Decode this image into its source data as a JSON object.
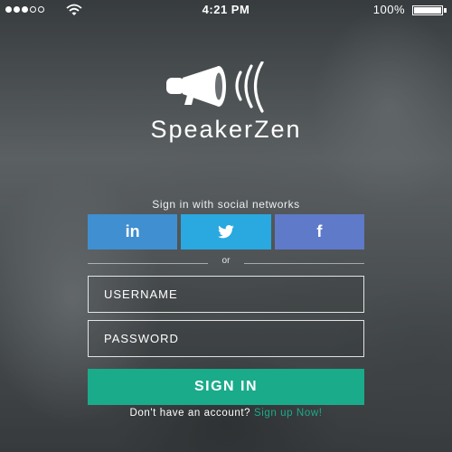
{
  "status_bar": {
    "time": "4:21 PM",
    "battery_percent": "100%",
    "battery_level": 1.0,
    "signal_bars_filled": 3,
    "signal_bars_total": 5
  },
  "brand": {
    "name": "SpeakerZen",
    "logo_icon": "megaphone-icon"
  },
  "social": {
    "label": "Sign in with social networks",
    "buttons": [
      {
        "text": "in",
        "icon": "linkedin-icon",
        "color": "#3f8fd1"
      },
      {
        "text": "",
        "icon": "twitter-icon",
        "color": "#2aa8e0"
      },
      {
        "text": "f",
        "icon": "facebook-icon",
        "color": "#5f7ac9"
      }
    ]
  },
  "divider": {
    "text": "or"
  },
  "form": {
    "username_placeholder": "USERNAME",
    "password_placeholder": "PASSWORD",
    "signin_label": "SIGN IN"
  },
  "footer": {
    "prompt": "Don't have an account?",
    "link": "Sign up Now!"
  },
  "colors": {
    "accent": "#1aab8b"
  }
}
